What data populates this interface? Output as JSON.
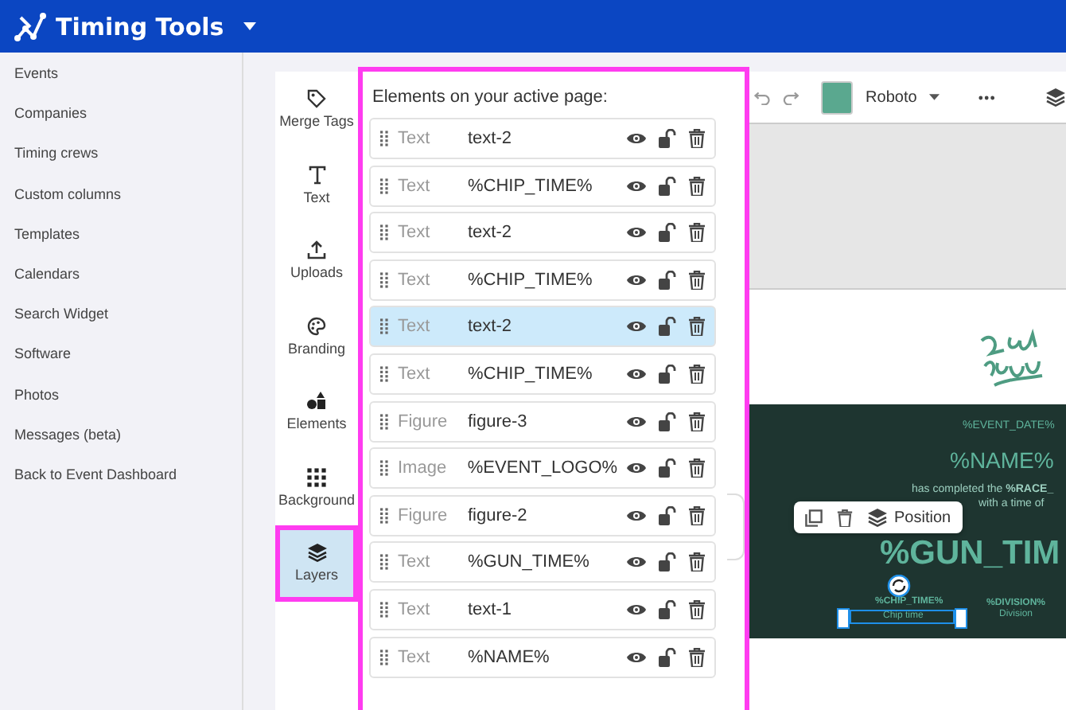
{
  "header": {
    "title": "Timing Tools"
  },
  "nav": [
    "Events",
    "Companies",
    "Timing crews",
    "Custom columns",
    "Templates",
    "Calendars",
    "Search Widget",
    "Software",
    "Photos",
    "Messages (beta)",
    "Back to Event Dashboard"
  ],
  "tools": [
    {
      "kind": "tag",
      "label": "Merge Tags",
      "selected": false
    },
    {
      "kind": "text",
      "label": "Text",
      "selected": false
    },
    {
      "kind": "upload",
      "label": "Uploads",
      "selected": false
    },
    {
      "kind": "palette",
      "label": "Branding",
      "selected": false
    },
    {
      "kind": "shapes",
      "label": "Elements",
      "selected": false
    },
    {
      "kind": "dots",
      "label": "Background",
      "selected": false
    },
    {
      "kind": "layers",
      "label": "Layers",
      "selected": true
    }
  ],
  "layers_panel": {
    "title": "Elements on your active page:",
    "rows": [
      {
        "type": "Text",
        "name": "text-2",
        "selected": false
      },
      {
        "type": "Text",
        "name": "%CHIP_TIME%",
        "selected": false
      },
      {
        "type": "Text",
        "name": "text-2",
        "selected": false
      },
      {
        "type": "Text",
        "name": "%CHIP_TIME%",
        "selected": false
      },
      {
        "type": "Text",
        "name": "text-2",
        "selected": true
      },
      {
        "type": "Text",
        "name": "%CHIP_TIME%",
        "selected": false
      },
      {
        "type": "Figure",
        "name": "figure-3",
        "selected": false
      },
      {
        "type": "Image",
        "name": "%EVENT_LOGO%",
        "selected": false
      },
      {
        "type": "Figure",
        "name": "figure-2",
        "selected": false
      },
      {
        "type": "Text",
        "name": "%GUN_TIME%",
        "selected": false
      },
      {
        "type": "Text",
        "name": "text-1",
        "selected": false
      },
      {
        "type": "Text",
        "name": "%NAME%",
        "selected": false
      }
    ]
  },
  "toolbar": {
    "color": "#5aa88f",
    "font": "Roboto"
  },
  "card": {
    "event_date": "%EVENT_DATE%",
    "name": "%NAME%",
    "completed": "has completed the **%RACE_**",
    "with_time": "with a time of",
    "gun_time": "%GUN_TIM",
    "chip_time": "%CHIP_TIME%",
    "chip_label": "Chip time",
    "division": "%DIVISION%",
    "division_label": "Division"
  },
  "popup": {
    "label": "Position"
  }
}
